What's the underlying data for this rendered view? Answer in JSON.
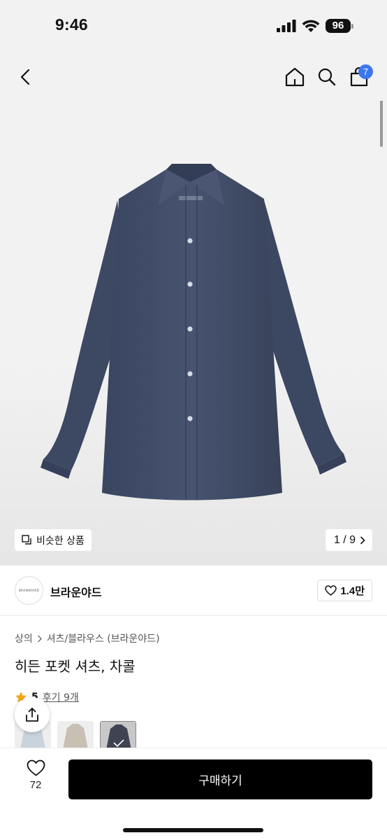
{
  "status_bar": {
    "time": "9:46",
    "battery": "96",
    "icons": [
      "cellular-signal-icon",
      "wifi-icon",
      "battery-icon"
    ]
  },
  "nav": {
    "icons": [
      "back-chevron-icon",
      "home-icon",
      "search-icon",
      "shopping-bag-icon"
    ],
    "cart_count": "7"
  },
  "gallery": {
    "similar_label": "비슷한 상품",
    "page_indicator": "1 / 9",
    "image_alt": "navy shirt product photo"
  },
  "brand": {
    "logo_text": "BROWNYARD",
    "name": "브라운야드",
    "likes": "1.4만"
  },
  "product": {
    "breadcrumb": [
      "상의",
      "셔츠/블라우스 (브라운야드)"
    ],
    "title": "히든 포켓 셔츠, 차콜",
    "rating": "5",
    "reviews_label": "후기 9개",
    "swatch_colors": [
      "#c9d3dc",
      "#c8c0b3",
      "#3e4452"
    ],
    "selected_swatch": 2
  },
  "bottom_bar": {
    "wishlist_count": "72",
    "buy_label": "구매하기"
  },
  "colors": {
    "accent_badge": "#3d76f0",
    "rating_star": "#f4a51c",
    "buy_button": "#000000",
    "shirt": "#3f4b66"
  }
}
